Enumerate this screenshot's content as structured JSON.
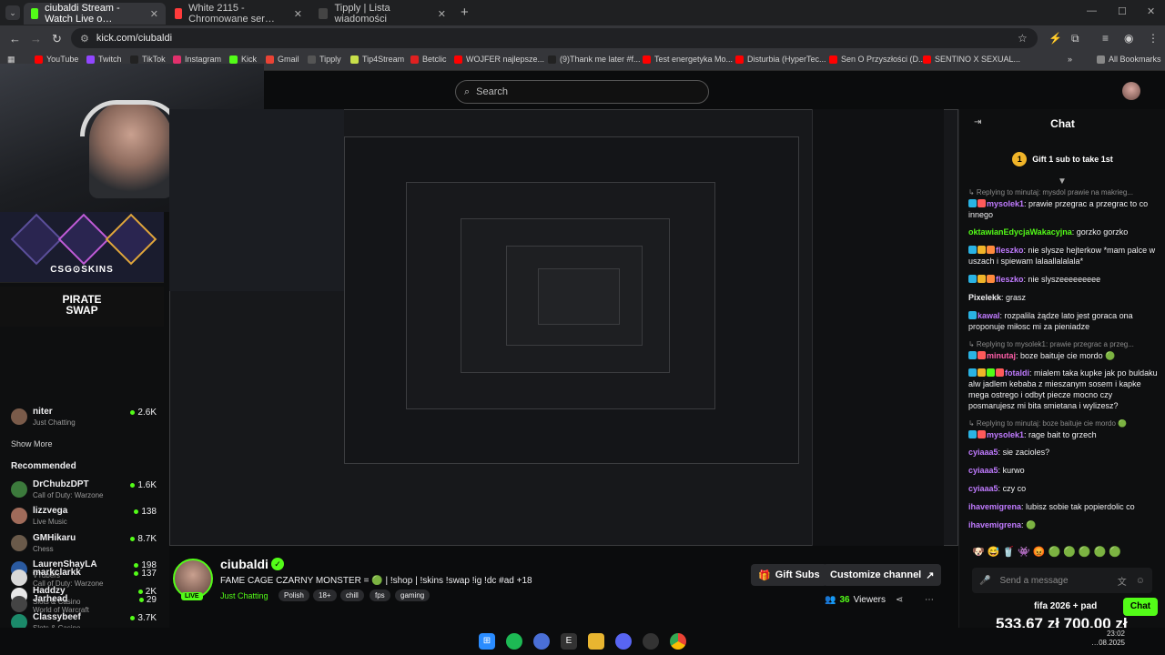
{
  "browser": {
    "tabs": [
      {
        "title": "ciubaldi Stream - Watch Live o…",
        "active": true
      },
      {
        "title": "White 2115 - Chromowane ser…",
        "active": false
      },
      {
        "title": "Tipply | Lista wiadomości",
        "active": false
      }
    ],
    "url": "kick.com/ciubaldi",
    "bookmarks": [
      "YouTube",
      "Twitch",
      "TikTok",
      "Instagram",
      "Kick",
      "Gmail",
      "Tipply",
      "Tip4Stream",
      "Betclic",
      "WOJFER najlepsze...",
      "(9)Thank me later #f...",
      "Test energetyka Mo...",
      "Disturbia (HyperTec...",
      "Sen O Przyszłości (D...",
      "SENTINO X SEXUAL..."
    ],
    "all_bookmarks": "All Bookmarks"
  },
  "site": {
    "search_placeholder": "Search"
  },
  "sidebar": {
    "sponsor1": "CSG⊙SKINS",
    "sponsor2_line1": "PIRATE",
    "sponsor2_line2": "SWAP",
    "following": [
      {
        "name": "niter",
        "category": "Just Chatting",
        "viewers": "2.6K"
      }
    ],
    "show_more": "Show More",
    "recommended_title": "Recommended",
    "recommended": [
      {
        "name": "DrChubzDPT",
        "category": "Call of Duty: Warzone",
        "viewers": "1.6K"
      },
      {
        "name": "lizzvega",
        "category": "Live Music",
        "viewers": "138"
      },
      {
        "name": "GMHikaru",
        "category": "Chess",
        "viewers": "8.7K"
      },
      {
        "name": "LaurenShayLA",
        "category": "VTubers",
        "viewers": "198"
      },
      {
        "name": "Haddzy",
        "category": "Slots & Casino",
        "viewers": "2K"
      },
      {
        "name": "Classybeef",
        "category": "Slots & Casino",
        "viewers": "3.7K"
      },
      {
        "name": "markclarkk",
        "category": "Call of Duty: Warzone",
        "viewers": "137"
      },
      {
        "name": "Jarhead",
        "category": "World of Warcraft",
        "viewers": "29"
      }
    ]
  },
  "channel": {
    "name": "ciubaldi",
    "live_label": "LIVE",
    "title": "FAME CAGE CZARNY MONSTER = 🟢 | !shop | !skins !swap !ig !dc #ad +18",
    "category": "Just Chatting",
    "tags": [
      "Polish",
      "18+",
      "chill",
      "fps",
      "gaming"
    ],
    "gift_subs": "Gift Subs",
    "customize": "Customize channel",
    "viewers": "36",
    "viewers_label": "Viewers"
  },
  "chat": {
    "title": "Chat",
    "gift_banner": "Gift 1 sub to take 1st",
    "gift_count": "1",
    "input_placeholder": "Send a message",
    "send": "Chat",
    "goal_title": "fifa 2026 + pad",
    "goal_amount": "533,67 zł    700,00 zł",
    "messages": [
      {
        "reply": "↳ Replying to minutaj: mysdol prawie na makrieg...",
        "user": "mysolek1",
        "color": "#c07bff",
        "text": "prawie przegrac a przegrac to co innego",
        "badges": [
          "#2ab3e3",
          "#ff5a5a"
        ]
      },
      {
        "reply": "",
        "user": "oktawianEdycjaWakacyjna",
        "color": "#53fc18",
        "text": "gorzko gorzko",
        "badges": []
      },
      {
        "reply": "",
        "user": "fleszko",
        "color": "#c07bff",
        "text": "nie slysze hejterkow *mam palce w uszach i spiewam lalaallalalala*",
        "badges": [
          "#2ab3e3",
          "#f0b429",
          "#ff8a3d"
        ]
      },
      {
        "reply": "",
        "user": "fleszko",
        "color": "#c07bff",
        "text": "nie slyszeeeeeeeee",
        "badges": [
          "#2ab3e3",
          "#f0b429",
          "#ff8a3d"
        ]
      },
      {
        "reply": "",
        "user": "Pixelekk",
        "color": "#efeff1",
        "text": "grasz",
        "badges": []
      },
      {
        "reply": "",
        "user": "kawal",
        "color": "#c07bff",
        "text": "rozpalila żądze lato jest goraca ona proponuje miłosc mi za pieniadze",
        "badges": [
          "#2ab3e3"
        ]
      },
      {
        "reply": "↳ Replying to mysolek1: prawie przegrac a przeg...",
        "user": "minutaj",
        "color": "#ff5ea8",
        "text": "boze baituje cie mordo 🟢",
        "badges": [
          "#2ab3e3",
          "#ff5a5a"
        ]
      },
      {
        "reply": "",
        "user": "fotaldi",
        "color": "#c07bff",
        "text": "mialem taka kupke jak po buldaku alw jadlem kebaba z mieszanym sosem i kapke mega ostrego i odbyt piecze mocno czy posmarujesz mi bita smietana i wylizesz?",
        "badges": [
          "#2ab3e3",
          "#f0b429",
          "#53fc18",
          "#ff5a5a"
        ]
      },
      {
        "reply": "↳ Replying to minutaj: boze baituje cie mordo 🟢",
        "user": "mysolek1",
        "color": "#c07bff",
        "text": "rage bait to grzech",
        "badges": [
          "#2ab3e3",
          "#ff5a5a"
        ]
      },
      {
        "reply": "",
        "user": "cyiaaa5",
        "color": "#c07bff",
        "text": "sie zacioles?",
        "badges": []
      },
      {
        "reply": "",
        "user": "cyiaaa5",
        "color": "#c07bff",
        "text": "kurwo",
        "badges": []
      },
      {
        "reply": "",
        "user": "cyiaaa5",
        "color": "#c07bff",
        "text": "czy co",
        "badges": []
      },
      {
        "reply": "",
        "user": "ihavemigrena",
        "color": "#c07bff",
        "text": "lubisz sobie tak popierdolic co",
        "badges": []
      },
      {
        "reply": "",
        "user": "ihavemigrena",
        "color": "#c07bff",
        "text": "🟢",
        "badges": []
      }
    ]
  },
  "taskbar": {
    "time": "23:02",
    "date": "…08.2025"
  },
  "colors": {
    "accent": "#53fc18",
    "bg": "#0b0c0d"
  }
}
